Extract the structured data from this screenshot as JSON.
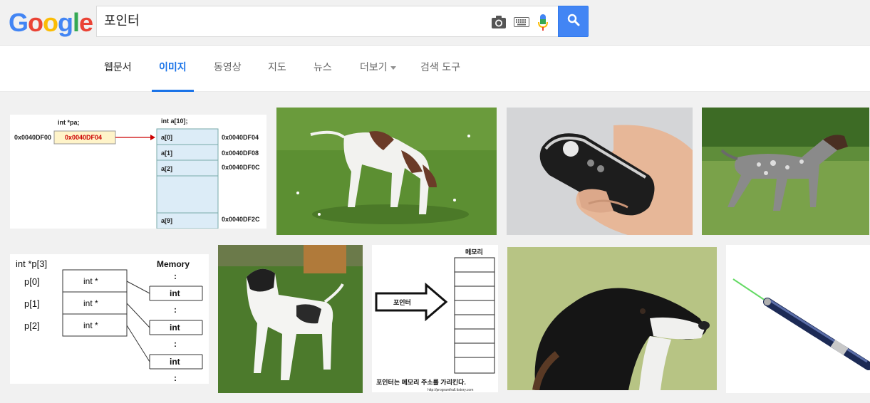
{
  "header": {
    "logo": {
      "letters": [
        "G",
        "o",
        "o",
        "g",
        "l",
        "e"
      ]
    },
    "search": {
      "query": "포인터"
    },
    "icons": [
      "camera-icon",
      "keyboard-icon",
      "microphone-icon",
      "search-icon"
    ]
  },
  "tabs": [
    {
      "label": "웹문서",
      "state": "normal"
    },
    {
      "label": "이미지",
      "state": "active"
    },
    {
      "label": "동영상",
      "state": "normal"
    },
    {
      "label": "지도",
      "state": "normal"
    },
    {
      "label": "뉴스",
      "state": "normal"
    },
    {
      "label": "더보기",
      "state": "dropdown"
    },
    {
      "label": "검색 도구",
      "state": "normal"
    }
  ],
  "diagram1": {
    "pa_label": "int *pa;",
    "pa_address": "0x0040DF00",
    "pa_value": "0x0040DF04",
    "array_label": "int a[10];",
    "cells": [
      "a[0]",
      "a[1]",
      "a[2]",
      "a[9]"
    ],
    "addresses": [
      "0x0040DF04",
      "0x0040DF08",
      "0x0040DF0C",
      "0x0040DF2C"
    ]
  },
  "diagram2": {
    "title": "int *p[3]",
    "memory_label": "Memory",
    "rows": [
      "p[0]",
      "p[1]",
      "p[2]"
    ],
    "cell_text": "int *",
    "mem_cell": "int",
    "dots": ":"
  },
  "diagram3": {
    "memory_label": "메모리",
    "arrow_label": "포인터",
    "caption": "포인터는 메모리 주소를 가리킨다.",
    "source": "http://programfrall.tistory.com"
  },
  "colors": {
    "accent": "#4285f4",
    "active_tab": "#1a73e8"
  }
}
